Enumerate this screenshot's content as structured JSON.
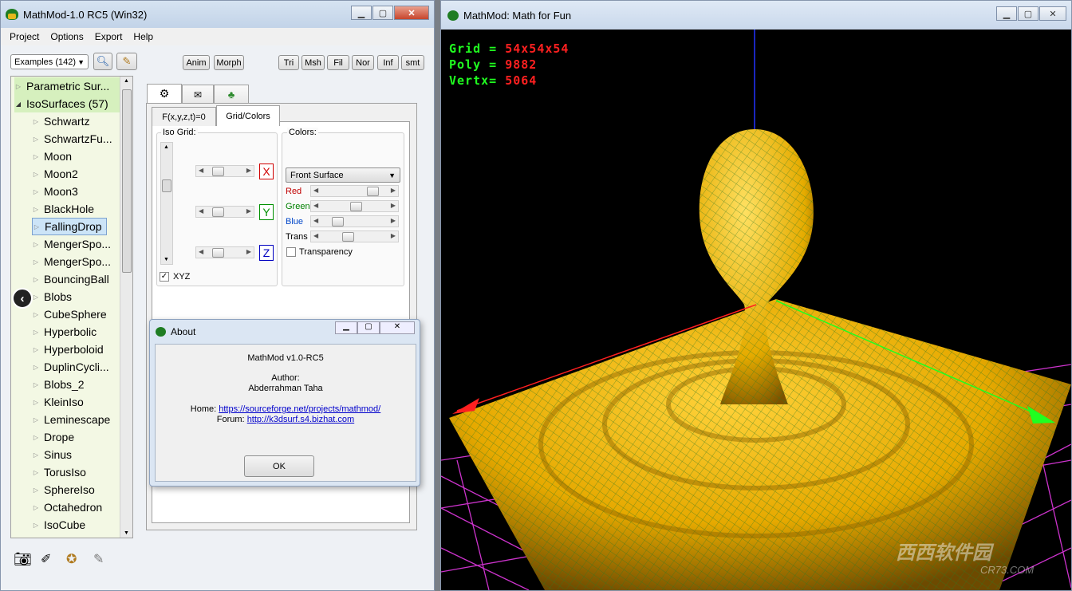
{
  "left_window": {
    "title": "MathMod-1.0 RC5 (Win32)",
    "menu": [
      "Project",
      "Options",
      "Export",
      "Help"
    ],
    "examples_label": "Examples (142)",
    "toolbar_buttons": [
      "Anim",
      "Morph",
      "Tri",
      "Msh",
      "Fil",
      "Nor",
      "Inf",
      "smt"
    ],
    "tree": {
      "parametric": "Parametric Sur...",
      "iso": "IsoSurfaces (57)",
      "items": [
        "Schwartz",
        "SchwartzFu...",
        "Moon",
        "Moon2",
        "Moon3",
        "BlackHole",
        "FallingDrop",
        "MengerSpo...",
        "MengerSpo...",
        "BouncingBall",
        "Blobs",
        "CubeSphere",
        "Hyperbolic",
        "Hyperboloid",
        "DuplinCycli...",
        "Blobs_2",
        "KleinIso",
        "Leminescape",
        "Drope",
        "Sinus",
        "TorusIso",
        "SphereIso",
        "Octahedron",
        "IsoCube"
      ],
      "selected": "FallingDrop"
    },
    "subtabs": [
      "F(x,y,z,t)=0",
      "Grid/Colors"
    ],
    "iso_grid": {
      "label": "Iso Grid:",
      "axes": [
        "X",
        "Y",
        "Z"
      ],
      "xyz_label": "XYZ",
      "xyz_checked": "✓"
    },
    "colors": {
      "label": "Colors:",
      "surface_select": "Front Surface",
      "channels": [
        {
          "name": "Red",
          "color": "#c00000",
          "level": 0.85
        },
        {
          "name": "Green",
          "color": "#008000",
          "level": 0.55
        },
        {
          "name": "Blue",
          "color": "#0046c8",
          "level": 0.2
        },
        {
          "name": "Trans",
          "color": "#000000",
          "level": 0.4
        }
      ],
      "transparency_label": "Transparency"
    }
  },
  "about_dialog": {
    "title": "About",
    "version": "MathMod v1.0-RC5",
    "author_label": "Author:",
    "author": "Abderrahman Taha",
    "home_label": "Home:",
    "home_url": "https://sourceforge.net/projects/mathmod/",
    "forum_label": "Forum:",
    "forum_url": "http://k3dsurf.s4.bizhat.com",
    "ok": "OK"
  },
  "right_window": {
    "title": "MathMod: Math for Fun",
    "grid_label": "Grid =",
    "grid_value": "54x54x54",
    "poly_label": "Poly =",
    "poly_value": "9882",
    "vertx_label": "Vertx=",
    "vertx_value": "5064",
    "watermark": "CR73.COM",
    "watermark_cn": "西西软件园"
  }
}
